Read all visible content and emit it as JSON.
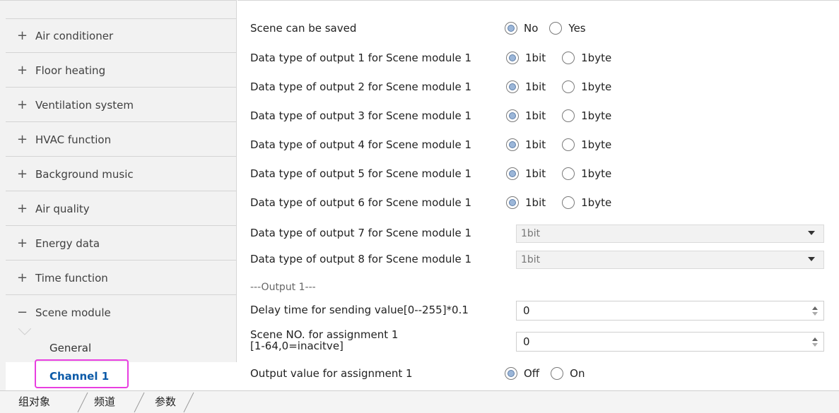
{
  "sidebar": {
    "items": [
      {
        "sign": "+",
        "label": "Air conditioner"
      },
      {
        "sign": "+",
        "label": "Floor heating"
      },
      {
        "sign": "+",
        "label": "Ventilation system"
      },
      {
        "sign": "+",
        "label": "HVAC function"
      },
      {
        "sign": "+",
        "label": "Background music"
      },
      {
        "sign": "+",
        "label": "Air quality"
      },
      {
        "sign": "+",
        "label": "Energy data"
      },
      {
        "sign": "+",
        "label": "Time function"
      },
      {
        "sign": "−",
        "label": "Scene module"
      }
    ],
    "subitems": [
      {
        "label": "General"
      },
      {
        "label": "Channel 1"
      }
    ]
  },
  "params": {
    "scene_saved": {
      "label": "Scene can be saved",
      "opt1": "No",
      "opt2": "Yes",
      "selected": "No"
    },
    "outputs": [
      {
        "label": "Data type of output 1 for Scene module 1",
        "opt1": "1bit",
        "opt2": "1byte"
      },
      {
        "label": "Data type of output 2 for Scene module 1",
        "opt1": "1bit",
        "opt2": "1byte"
      },
      {
        "label": "Data type of output 3 for Scene module 1",
        "opt1": "1bit",
        "opt2": "1byte"
      },
      {
        "label": "Data type of output 4 for Scene module 1",
        "opt1": "1bit",
        "opt2": "1byte"
      },
      {
        "label": "Data type of output 5 for Scene module 1",
        "opt1": "1bit",
        "opt2": "1byte"
      },
      {
        "label": "Data type of output 6 for Scene module 1",
        "opt1": "1bit",
        "opt2": "1byte"
      }
    ],
    "output7": {
      "label": "Data type of output 7 for Scene module 1",
      "value": "1bit"
    },
    "output8": {
      "label": "Data type of output 8 for Scene module 1",
      "value": "1bit"
    },
    "section": "---Output 1---",
    "delay": {
      "label": "Delay time for sending value[0--255]*0.1",
      "value": "0"
    },
    "scene_no": {
      "label_line1": "Scene NO. for assignment 1",
      "label_line2": "[1-64,0=inacitve]",
      "value": "0"
    },
    "output_value": {
      "label": "Output value for assignment 1",
      "opt1": "Off",
      "opt2": "On",
      "selected": "Off"
    }
  },
  "tabs": [
    "组对象",
    "频道",
    "参数"
  ],
  "colors": {
    "highlight": "#e83ee0",
    "active_text": "#0b5aa8",
    "radio_fill": "#9bb6d8"
  }
}
